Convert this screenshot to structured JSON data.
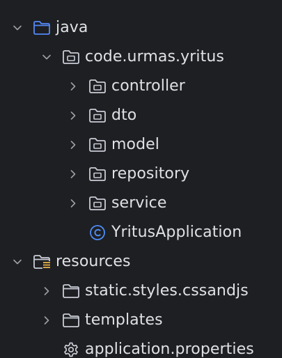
{
  "tree": {
    "items": [
      {
        "label": "java"
      },
      {
        "label": "code.urmas.yritus"
      },
      {
        "label": "controller"
      },
      {
        "label": "dto"
      },
      {
        "label": "model"
      },
      {
        "label": "repository"
      },
      {
        "label": "service"
      },
      {
        "label": "YritusApplication"
      },
      {
        "label": "resources"
      },
      {
        "label": "static.styles.cssandjs"
      },
      {
        "label": "templates"
      },
      {
        "label": "application.properties"
      }
    ]
  },
  "colors": {
    "background": "#1e1f22",
    "text": "#dfe1e5",
    "chevron": "#9da0a8",
    "folder_blue": "#548af7",
    "folder_gray": "#c9ccd6",
    "class_icon": "#4d8cf5",
    "resources_badge": "#e6b34b"
  }
}
